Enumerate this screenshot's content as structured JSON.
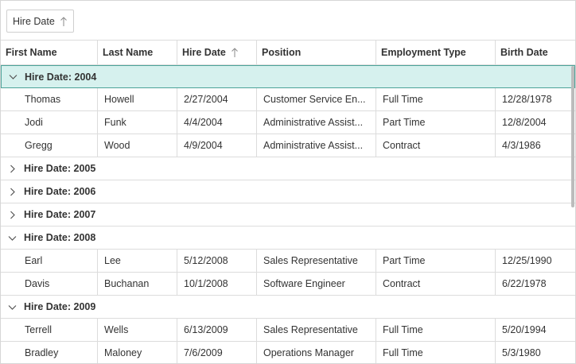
{
  "group_panel": {
    "chip_label": "Hire Date",
    "chip_icon": "arrow-up-icon"
  },
  "columns": [
    "First Name",
    "Last Name",
    "Hire Date",
    "Position",
    "Employment Type",
    "Birth Date"
  ],
  "colors": {
    "selected_group_bg": "#d6f1ee",
    "selected_group_border": "#4ba399",
    "grid_line": "#dcdcdc"
  },
  "groups": [
    {
      "label": "Hire Date: 2004",
      "expanded": true,
      "selected": true,
      "rows": [
        [
          "Thomas",
          "Howell",
          "2/27/2004",
          "Customer Service En...",
          "Full Time",
          "12/28/1978"
        ],
        [
          "Jodi",
          "Funk",
          "4/4/2004",
          "Administrative Assist...",
          "Part Time",
          "12/8/2004"
        ],
        [
          "Gregg",
          "Wood",
          "4/9/2004",
          "Administrative Assist...",
          "Contract",
          "4/3/1986"
        ]
      ]
    },
    {
      "label": "Hire Date: 2005",
      "expanded": false,
      "selected": false,
      "rows": []
    },
    {
      "label": "Hire Date: 2006",
      "expanded": false,
      "selected": false,
      "rows": []
    },
    {
      "label": "Hire Date: 2007",
      "expanded": false,
      "selected": false,
      "rows": []
    },
    {
      "label": "Hire Date: 2008",
      "expanded": true,
      "selected": false,
      "rows": [
        [
          "Earl",
          "Lee",
          "5/12/2008",
          "Sales Representative",
          "Part Time",
          "12/25/1990"
        ],
        [
          "Davis",
          "Buchanan",
          "10/1/2008",
          "Software Engineer",
          "Contract",
          "6/22/1978"
        ]
      ]
    },
    {
      "label": "Hire Date: 2009",
      "expanded": true,
      "selected": false,
      "rows": [
        [
          "Terrell",
          "Wells",
          "6/13/2009",
          "Sales Representative",
          "Full Time",
          "5/20/1994"
        ],
        [
          "Bradley",
          "Maloney",
          "7/6/2009",
          "Operations Manager",
          "Full Time",
          "5/3/1980"
        ]
      ]
    }
  ]
}
